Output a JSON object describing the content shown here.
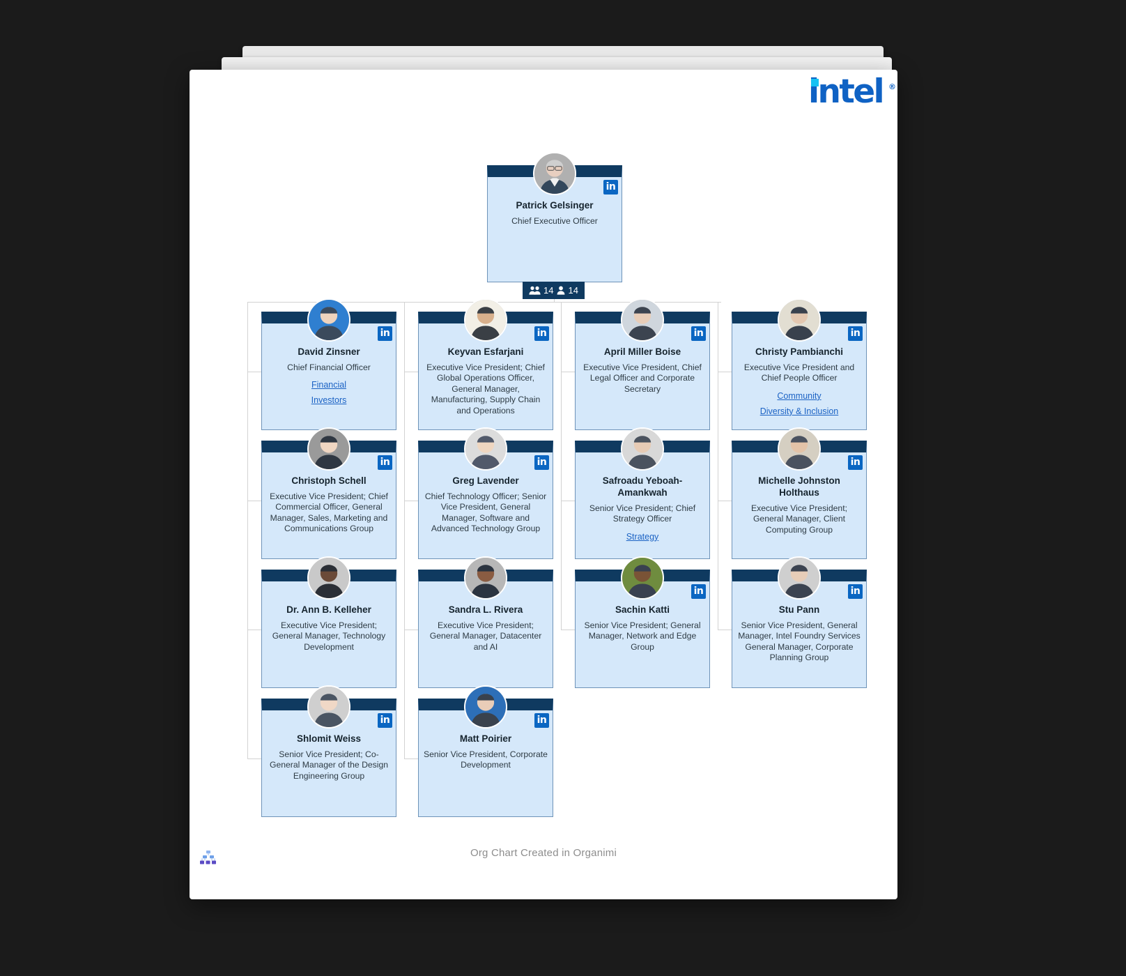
{
  "brand": {
    "logo_text": "intel",
    "logo_registered": "®",
    "logo_color": "#0f62c4",
    "logo_dot_color": "#16c2f3"
  },
  "footer": {
    "text": "Org Chart Created in Organimi",
    "logo_icon": "organimi-org-chart-icon"
  },
  "theme": {
    "card_bg": "#d5e8fa",
    "card_header": "#0f3a60",
    "card_border": "#6e93b8",
    "link_color": "#1b62c4",
    "linkedin_blue": "#0a66c2",
    "connector": "#d2d2d2"
  },
  "ceo": {
    "name": "Patrick Gelsinger",
    "title": "Chief Executive Officer",
    "linkedin": true,
    "counter": {
      "group_icon": "people-group-icon",
      "group_count": "14",
      "person_icon": "person-icon",
      "person_count": "14"
    }
  },
  "columns": [
    {
      "nodes": [
        {
          "name": "David Zinsner",
          "title": "Chief Financial Officer",
          "linkedin": true,
          "links": [
            "Financial",
            "Investors"
          ]
        },
        {
          "name": "Christoph Schell",
          "title": "Executive Vice President; Chief Commercial Officer, General Manager, Sales, Marketing and Communications Group",
          "linkedin": true,
          "links": []
        },
        {
          "name": "Dr. Ann B. Kelleher",
          "title": "Executive Vice President; General Manager, Technology Development",
          "linkedin": false,
          "links": []
        },
        {
          "name": "Shlomit Weiss",
          "title": "Senior Vice President; Co-General Manager of the Design Engineering Group",
          "linkedin": true,
          "links": []
        }
      ]
    },
    {
      "nodes": [
        {
          "name": "Keyvan Esfarjani",
          "title": "Executive Vice President; Chief Global Operations Officer, General Manager, Manufacturing, Supply Chain and Operations",
          "linkedin": true,
          "links": []
        },
        {
          "name": "Greg Lavender",
          "title": "Chief Technology Officer; Senior Vice President, General Manager, Software and Advanced Technology Group",
          "linkedin": true,
          "links": []
        },
        {
          "name": "Sandra L. Rivera",
          "title": "Executive Vice President; General Manager, Datacenter and AI",
          "linkedin": false,
          "links": []
        },
        {
          "name": "Matt Poirier",
          "title": "Senior Vice President, Corporate Development",
          "linkedin": true,
          "links": []
        }
      ]
    },
    {
      "nodes": [
        {
          "name": "April Miller Boise",
          "title": "Executive Vice President, Chief Legal Officer and Corporate Secretary",
          "linkedin": true,
          "links": []
        },
        {
          "name": "Safroadu Yeboah-Amankwah",
          "title": "Senior Vice President; Chief Strategy Officer",
          "linkedin": false,
          "links": [
            "Strategy"
          ]
        },
        {
          "name": "Sachin Katti",
          "title": "Senior Vice President; General Manager, Network and Edge Group",
          "linkedin": true,
          "links": []
        }
      ]
    },
    {
      "nodes": [
        {
          "name": "Christy Pambianchi",
          "title": "Executive Vice President and Chief People Officer",
          "linkedin": true,
          "links": [
            "Community",
            "Diversity & Inclusion"
          ]
        },
        {
          "name": "Michelle Johnston Holthaus",
          "title": "Executive Vice President; General Manager, Client Computing Group",
          "linkedin": true,
          "links": []
        },
        {
          "name": "Stu Pann",
          "title": "Senior Vice President, General Manager, Intel Foundry Services General Manager, Corporate Planning Group",
          "linkedin": true,
          "links": []
        }
      ]
    }
  ]
}
